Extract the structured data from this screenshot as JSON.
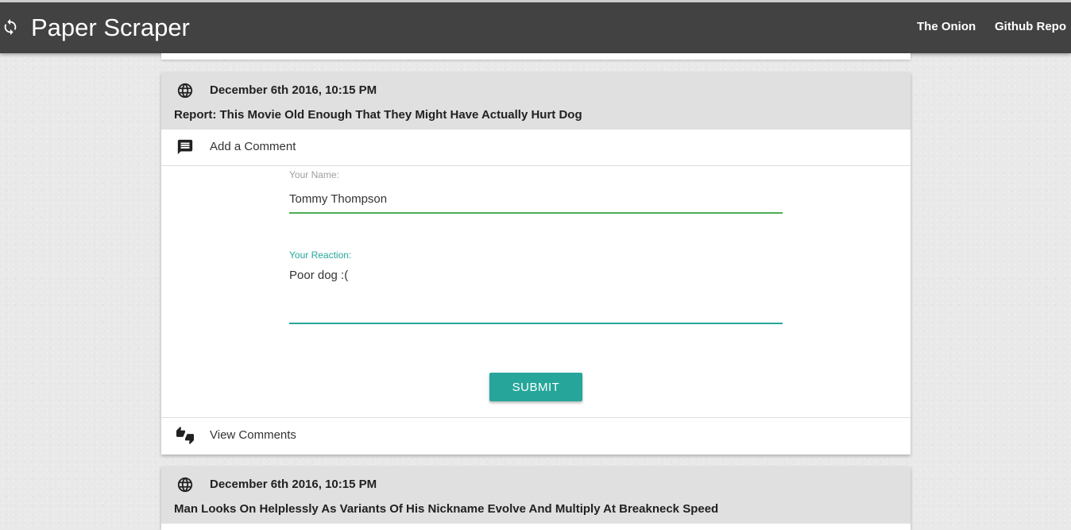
{
  "navbar": {
    "brand_icon": "sync-icon",
    "title": "Paper Scraper",
    "links": [
      "The Onion",
      "Github Repo"
    ]
  },
  "articles": [
    {
      "date": "December 6th 2016, 10:15 PM",
      "headline": "Report: This Movie Old Enough That They Might Have Actually Hurt Dog",
      "add_comment_label": "Add a Comment",
      "form": {
        "name_label": "Your Name:",
        "name_value": "Tommy Thompson",
        "reaction_label": "Your Reaction:",
        "reaction_value": "Poor dog :(",
        "submit_label": "SUBMIT"
      },
      "view_comments_label": "View Comments"
    },
    {
      "date": "December 6th 2016, 10:15 PM",
      "headline": "Man Looks On Helplessly As Variants Of His Nickname Evolve And Multiply At Breakneck Speed"
    }
  ],
  "colors": {
    "navbar": "#424242",
    "card_header": "#e0e0e0",
    "accent": "#26a69a",
    "valid": "#4caf50"
  }
}
